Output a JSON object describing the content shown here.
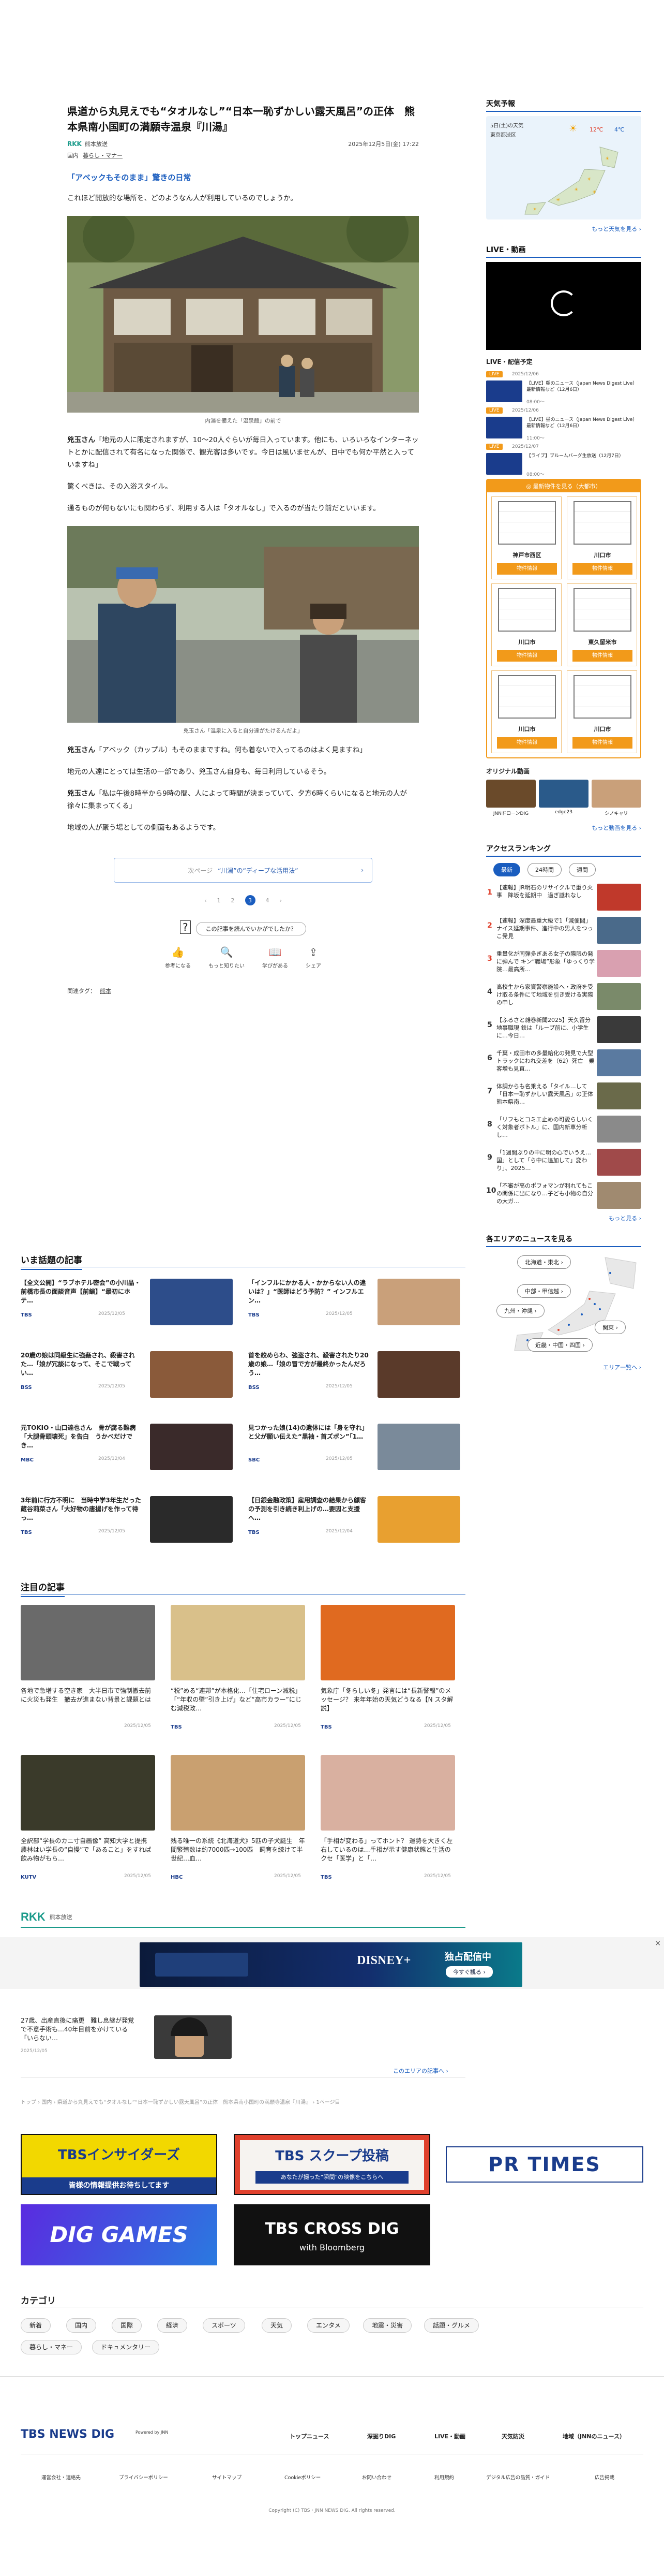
{
  "article": {
    "title": "県道から丸見えでも“タオルなし”“日本一恥ずかしい露天風呂”の正体　熊本県南小国町の満願寺温泉『川湯』",
    "source": "熊本放送",
    "source_logo": "RKK",
    "date": "2025年12月5日(金) 17:22",
    "categories": [
      "国内",
      "暮らし・マナー"
    ],
    "subhead": "「アベックもそのまま」驚きの日常",
    "p1": "これほど開放的な場所を、どのようなん人が利用しているのでしょうか。",
    "photo1_caption": "内湯を備えた「温泉館」の前で",
    "p2_name": "兇玉さん",
    "p2": "「地元の人に限定されますが、10〜20人ぐらいが毎日入っています。他にも、いろいろなインターネットとかに配信されて有名になった関係で、観光客は多いです。今日は風いませんが、日中でも何か平然と入っていますね」",
    "p3": "驚くべきは、その入浴スタイル。",
    "p4": "通るものが何もないにも関わらず、利用する人は「タオルなし」で入るのが当たり前だといいます。",
    "photo2_caption": "兇玉さん「温泉に入ると自分達がたけるんだよ」",
    "p5_name": "兇玉さん",
    "p5": "「アベック（カップル）もそのままですね。何も着ないで入ってるのはよく見ますね」",
    "p6": "地元の人達にとっては生活の一部であり、兇玉さん自身も、毎日利用しているそう。",
    "p7_name": "兇玉さん",
    "p7": "「私は午後8時半から9時の間、人によって時間が決まっていて、夕方6時くらいになると地元の人が徐々に集まってくる」",
    "p8": "地域の人が聚う場としての側面もあるようです。",
    "next_prefix": "次ページ",
    "next_label": "“川湯”の“ディープな活用法”",
    "pages": [
      "‹",
      "1",
      "2",
      "3",
      "4",
      "›"
    ],
    "current_page": "3",
    "reaction_question": "この記事を読んでいかがでしたか？",
    "reactions": [
      "参考になる",
      "もっと知りたい",
      "学びがある",
      "シェア"
    ],
    "related_tag_label": "関連タグ：",
    "related_tag": "熊本"
  },
  "hot": {
    "title": "いま話題の記事",
    "items": [
      {
        "text": "【全文公開】“ラブホテル密会”の小川晶・前橋市長の面談音声【前編】“最初にホテ…",
        "src": "TBS",
        "date": "2025/12/05"
      },
      {
        "text": "「インフルにかかる人・かからない人の違いは？」“医師はどう予防？” インフルエン…",
        "src": "TBS",
        "date": "2025/12/05"
      },
      {
        "text": "20歳の娘は同級生に強姦され、殺害された…「娘が冗談になって、そこで戦ってい…",
        "src": "BSS",
        "date": "2025/12/05"
      },
      {
        "text": "首を絞めらわ、強盗され、殺害されたり20歳の娘…「娘の冒で方が最終かったんだろう…",
        "src": "BSS",
        "date": "2025/12/05"
      },
      {
        "text": "元TOKIO・山口達也さん　骨が腐る難病「大腿骨頭壊死」を告白　うかべだけでき…",
        "src": "MBC",
        "date": "2025/12/04"
      },
      {
        "text": "見つかった娘(14)の遺体には「身を守れ」と父が願い伝えた“黒袖・首ズボン”「1…",
        "src": "SBC",
        "date": "2025/12/05"
      },
      {
        "text": "3年前に行方不明に　当時中学3年生だった蔵谷莉菜さん「大好物の唐揚げを作って待っ…",
        "src": "TBS",
        "date": "2025/12/05"
      },
      {
        "text": "【日銀金融政策】雇用調査の結果から顧客の予測を引き続き利上げの…要因と支援へ…",
        "src": "TBS",
        "date": "2025/12/04"
      }
    ]
  },
  "featured": {
    "title": "注目の記事",
    "items": [
      {
        "text": "各地で急増する空き家　大半日市で強制撤去前に火災も発生　撤去が進まない背景と課題とは",
        "src": "",
        "date": "2025/12/05"
      },
      {
        "text": "“税”める“連邦”が本格化…「住宅ローン減税」「“年収の壁”引き上げ」など“高市カラー”にじむ減税政…",
        "src": "TBS",
        "date": "2025/12/05"
      },
      {
        "text": "気象庁「冬らしい冬」発言には“長新警報”のメッセージ？ 来年年始の天気どうなる【N スタ解説】",
        "src": "TBS",
        "date": "2025/12/05"
      },
      {
        "text": "全訳部“学長のカニ寸自画像” 高知大学と提携　農林はい学長の“自慢”で「あること」をすれば飲み物がもら…",
        "src": "KUTV",
        "date": "2025/12/05"
      },
      {
        "text": "残る唯一の系統《北海道犬》5匹の子犬誕生　年間繁殖数は約7000匹→100匹　飼育を続けて半世紀…血…",
        "src": "HBC",
        "date": "2025/12/05"
      },
      {
        "text": "「手相が変わる」ってホント？ 運勢を大きく左右しているのは…手相が示す健康状態と生活のクセ「医学」と「…",
        "src": "TBS",
        "date": "2025/12/05"
      }
    ]
  },
  "rkk": {
    "logo": "RKK",
    "name": "熊本放送",
    "item_text": "27歳、出産直後に痛更　難し息継が発覚で不意手術も…40年目前をかけている「いらない…",
    "item_date": "2025/12/05",
    "more": "このエリアの記事へ ›"
  },
  "ad": {
    "brand": "DISNEY+",
    "copy": "独占配信中",
    "cta": "今すぐ観る ›",
    "close": "×"
  },
  "breadcrumb": "トップ ›  国内 ›  県道から丸見えでも“タオルなし”“日本一恥ずかしい露天風呂”の正体　熊本県南小国町の満願寺温泉『川湯』 ›  1ページ目",
  "banners": {
    "insiders": "TBSインサイダーズ",
    "insiders_sub": "皆様の情報提供お待ちしてます",
    "scoop": "TBS スクープ投稿",
    "scoop_sub": "あなたが撮った“瞬間”の映像をこちらへ",
    "prtimes": "PR TIMES",
    "diggames": "DIG GAMES",
    "crossdig": "TBS CROSS DIG",
    "crossdig_sub": "with Bloomberg"
  },
  "categories_section": {
    "title": "カテゴリ",
    "row1": [
      "新着",
      "国内",
      "国際",
      "経済",
      "スポーツ",
      "天気",
      "エンタメ",
      "地震・災害",
      "話題・グルメ"
    ],
    "row2": [
      "暮らし・マネー",
      "ドキュメンタリー"
    ]
  },
  "footer": {
    "logo": "TBS NEWS DIG",
    "logo_sub": "Powered by JNN",
    "nav": [
      "トップニュース",
      "深掘りDIG",
      "LIVE・動画",
      "天気防災",
      "地域（JNNのニュース）"
    ],
    "links": [
      "運営会社・連絡先",
      "プライバシーポリシー",
      "サイトマップ",
      "Cookieポリシー",
      "お問い合わせ",
      "利用規約",
      "デジタル広告の品質・ガイド",
      "広告掲載"
    ],
    "copyright": "Copyright (C) TBS・JNN NEWS DIG. All rights reserved."
  },
  "sidebar": {
    "weather_title": "天気予報",
    "weather_date": "5日(土)の天気",
    "weather_place": "東京都渋区",
    "weather_temp_hi": "12℃",
    "weather_temp_lo": "4℃",
    "weather_more": "もっと天気を見る ›",
    "live_title": "LIVE・動画",
    "live_schedule_title": "LIVE・配信予定",
    "live_items": [
      {
        "badge": "LIVE",
        "date": "2025/12/06",
        "text": "【LIVE】朝のニュース（Japan News Digest Live）最新情報など（12月6日）",
        "time": "08:00〜"
      },
      {
        "badge": "LIVE",
        "date": "2025/12/06",
        "text": "【LIVE】昼のニュース（Japan News Digest Live）最新情報など（12月6日）",
        "time": "11:00〜"
      },
      {
        "badge": "LIVE",
        "date": "2025/12/07",
        "text": "【ライブ】ブルームバーグ生放送（12月7日）",
        "time": "08:00〜"
      }
    ],
    "property_title": "◎ 最新物件を見る（大都市）",
    "properties": [
      {
        "area": "神戸市西区",
        "btn": "物件情報"
      },
      {
        "area": "川口市",
        "btn": "物件情報"
      },
      {
        "area": "川口市",
        "btn": "物件情報"
      },
      {
        "area": "東久留米市",
        "btn": "物件情報"
      },
      {
        "area": "川口市",
        "btn": "物件情報"
      },
      {
        "area": "川口市",
        "btn": "物件情報"
      }
    ],
    "original_title": "オリジナル動画",
    "originals": [
      "JNNドローンDIG",
      "edge23",
      "シノキャリ"
    ],
    "original_more": "もっと動画を見る ›",
    "ranking_title": "アクセスランキング",
    "ranking_tabs": [
      "最新",
      "24時間",
      "週間"
    ],
    "ranking": [
      {
        "n": "1",
        "text": "【速報】JR明石のリサイクルで重り火事　降坂を延期中　過ぎ謎れなし"
      },
      {
        "n": "2",
        "text": "【速報】深度最重大級で1「減便間」ナイス延期事件、進行中の男人をつっこ発見"
      },
      {
        "n": "3",
        "text": "重量化が同弾多ぎある女子の際限の発に弾んで キン“職場”形象「ゆっくり学院…最高所…"
      },
      {
        "n": "4",
        "text": "高校生から家資警察施設へ・政府を受け取る条件にて地域を引き受ける実際の申し"
      },
      {
        "n": "5",
        "text": "【ふるさと雑巻新聞2025】天久留分地事職現 鉄は「ループ前に、小学生に…今日…"
      },
      {
        "n": "6",
        "text": "千葉・成田市の多量給化の発見で大型トラックにわれ交差を（62）死亡　乗客増も見直…"
      },
      {
        "n": "7",
        "text": "体調からも名乗える「タイル…して「日本一恥ずかしい露天風呂」の正体　熊本県南…"
      },
      {
        "n": "8",
        "text": "「リフもとコミエ止めの可愛らしいくく対象者ボトル」に、国内新車分析し…"
      },
      {
        "n": "9",
        "text": "「1週間ぶりの中に明の心でいうえ…国」として「ら中に追加して」変わり」、2025…"
      },
      {
        "n": "10",
        "text": "「不審が高のポフォマンが利れてもこの関係に出になり…子ども小物の自分の大ガ…"
      }
    ],
    "ranking_more": "もっと見る ›",
    "area_title": "各エリアのニュースを見る",
    "areas": [
      "北海道・東北 ›",
      "中部・甲信越 ›",
      "九州・沖縄 ›",
      "関東 ›",
      "近畿・中国・四国 ›"
    ],
    "area_more": "エリア一覧へ ›"
  }
}
